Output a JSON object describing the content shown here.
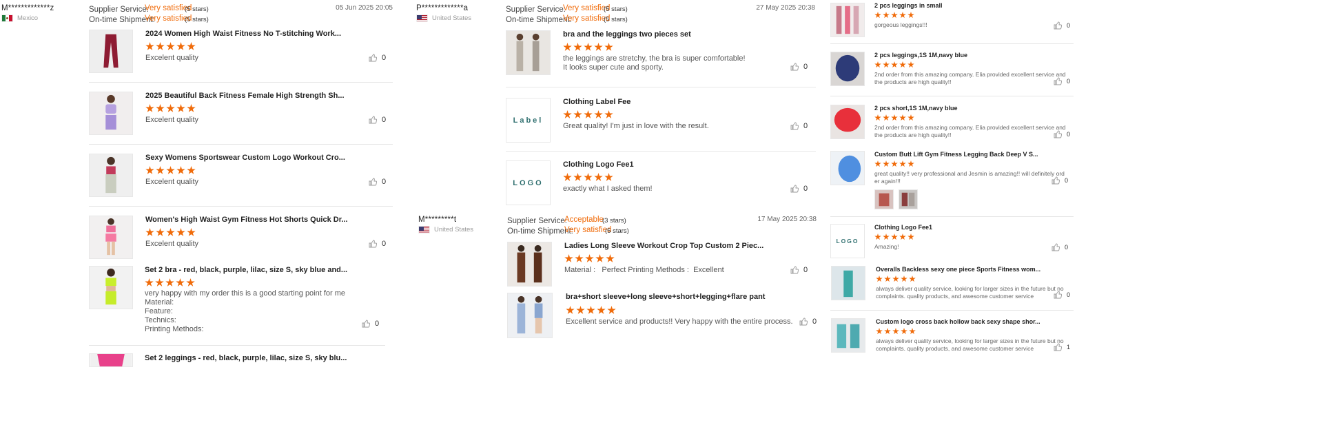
{
  "column1": {
    "user": "M*************z",
    "country": "Mexico",
    "supplier_service_label": "Supplier Service:",
    "supplier_service_value": "Very satisfied",
    "supplier_service_stars": "(5 stars)",
    "shipment_label": "On-time Shipment:",
    "shipment_value": "Very satisfied",
    "shipment_stars": "(5 stars)",
    "date": "05 Jun 2025 20:05",
    "items": [
      {
        "title": "2024 Women High Waist Fitness No T-stitching Work...",
        "comment": "Excelent quality",
        "likes": "0"
      },
      {
        "title": "2025 Beautiful Back Fitness Female High Strength Sh...",
        "comment": "Excelent quality",
        "likes": "0"
      },
      {
        "title": "Sexy Womens Sportswear Custom Logo Workout Cro...",
        "comment": "Excelent quality",
        "likes": "0"
      },
      {
        "title": "Women's High Waist Gym Fitness Hot Shorts Quick Dr...",
        "comment": "Excelent quality",
        "likes": "0"
      },
      {
        "title": "Set 2 bra - red, black, purple, lilac, size S, sky blue and...",
        "comment_lines": [
          "very happy with my order this is a good starting point for me",
          "Material:",
          "Feature:",
          "Technics:",
          "Printing Methods:"
        ],
        "likes": "0"
      },
      {
        "title": "Set 2 leggings - red, black, purple, lilac, size S, sky blu..."
      }
    ]
  },
  "column2": {
    "review1": {
      "user": "P*************a",
      "country": "United States",
      "supplier_service_label": "Supplier Service:",
      "supplier_service_value": "Very satisfied",
      "supplier_service_stars": "(5 stars)",
      "shipment_label": "On-time Shipment:",
      "shipment_value": "Very satisfied",
      "shipment_stars": "(5 stars)",
      "date": "27 May 2025 20:38",
      "items": [
        {
          "title": "bra and the leggings two pieces set",
          "comment_lines": [
            "the leggings are stretchy, the bra is super comfortable!",
            "It looks super cute and sporty."
          ],
          "likes": "0"
        },
        {
          "title": "Clothing Label Fee",
          "thumb_text": "Label",
          "comment": "Great quality! I'm just in love with the result.",
          "likes": "0"
        },
        {
          "title": "Clothing Logo Fee1",
          "thumb_text": "LOGO",
          "comment": "exactly what I asked them!",
          "likes": "0"
        }
      ]
    },
    "review2": {
      "user": "M*********t",
      "country": "United States",
      "supplier_service_label": "Supplier Service:",
      "supplier_service_value": "Acceptable",
      "supplier_service_stars": "(3 stars)",
      "shipment_label": "On-time Shipment:",
      "shipment_value": "Very satisfied",
      "shipment_stars": "(5 stars)",
      "date": "17 May 2025 20:38",
      "items": [
        {
          "title": "Ladies Long Sleeve Workout Crop Top Custom 2 Piec...",
          "comment": "Material :   Perfect Printing Methods :  Excellent",
          "likes": "0"
        },
        {
          "title": "bra+short sleeve+long sleeve+short+legging+flare pant",
          "comment": "Excellent service and products!! Very happy with the entire process.",
          "likes": "0"
        }
      ]
    }
  },
  "column3": {
    "items": [
      {
        "title": "2 pcs leggings in small",
        "comment_lines": [
          "gorgeous leggings!!!"
        ],
        "likes": "0"
      },
      {
        "title": "2 pcs leggings,1S 1M,navy blue",
        "comment_lines": [
          "2nd order from this amazing company. Elia provided excellent service and",
          "the products are high quality!!"
        ],
        "likes": "0"
      },
      {
        "title": "2 pcs short,1S 1M,navy blue",
        "comment_lines": [
          "2nd order from this amazing company. Elia provided excellent service and",
          "the products are high quality!!"
        ],
        "likes": "0"
      },
      {
        "title": "Custom Butt Lift Gym Fitness Legging Back Deep V S...",
        "comment_lines": [
          "great quality!! very professional and Jesmin is amazing!! will definitely ord",
          "er again!!!"
        ],
        "likes": "0"
      },
      {
        "title": "Clothing Logo Fee1",
        "thumb_text": "LOGO",
        "comment_lines": [
          "Amazing!"
        ],
        "likes": "0"
      },
      {
        "title": "Overalls Backless sexy one piece Sports Fitness wom...",
        "comment_lines": [
          "always deliver quality service, looking for larger sizes in the future but no",
          "complaints. quality products, and awesome customer service"
        ],
        "likes": "0"
      },
      {
        "title": "Custom logo cross back hollow back sexy shape shor...",
        "comment_lines": [
          "always deliver quality service, looking for larger sizes in the future but no",
          "complaints. quality products, and awesome customer service"
        ],
        "likes": "1"
      }
    ]
  },
  "colors": {
    "accent": "#f06b0a",
    "separator": "#e6e6e6",
    "muted": "#999999"
  },
  "icons": [
    "thumbs-up-icon",
    "star-icon",
    "flag-mexico-icon",
    "flag-usa-icon"
  ]
}
